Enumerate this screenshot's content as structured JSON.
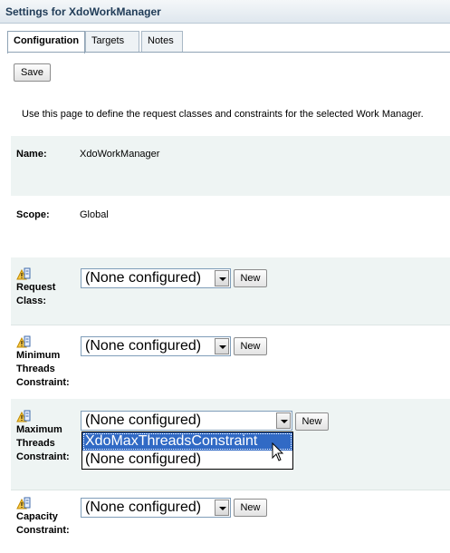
{
  "window": {
    "title": "Settings for XdoWorkManager"
  },
  "tabs": [
    {
      "label": "Configuration",
      "active": true
    },
    {
      "label": "Targets",
      "active": false
    },
    {
      "label": "Notes",
      "active": false
    }
  ],
  "toolbar": {
    "save_label": "Save"
  },
  "intro": "Use this page to define the request classes and constraints for the selected Work Manager.",
  "fields": {
    "name": {
      "label": "Name:",
      "value": "XdoWorkManager"
    },
    "scope": {
      "label": "Scope:",
      "value": "Global"
    },
    "request_class": {
      "label_1": "Request",
      "label_2": "Class:",
      "selected": "(None configured)",
      "new_label": "New"
    },
    "min_threads": {
      "label_1": "Minimum",
      "label_2": "Threads",
      "label_3": "Constraint:",
      "selected": "(None configured)",
      "new_label": "New"
    },
    "max_threads": {
      "label_1": "Maximum",
      "label_2": "Threads",
      "label_3": "Constraint:",
      "selected": "(None configured)",
      "new_label": "New",
      "options": [
        "XdoMaxThreadsConstraint",
        "(None configured)"
      ],
      "highlighted": "XdoMaxThreadsConstraint"
    },
    "capacity": {
      "label_1": "Capacity",
      "label_2": "Constraint:",
      "selected": "(None configured)",
      "new_label": "New"
    }
  },
  "icons": {
    "field_help": "warning-info-icon"
  },
  "colors": {
    "title_text": "#1f3b57",
    "row_shade": "#eef4f3",
    "selection": "#316ac5"
  }
}
